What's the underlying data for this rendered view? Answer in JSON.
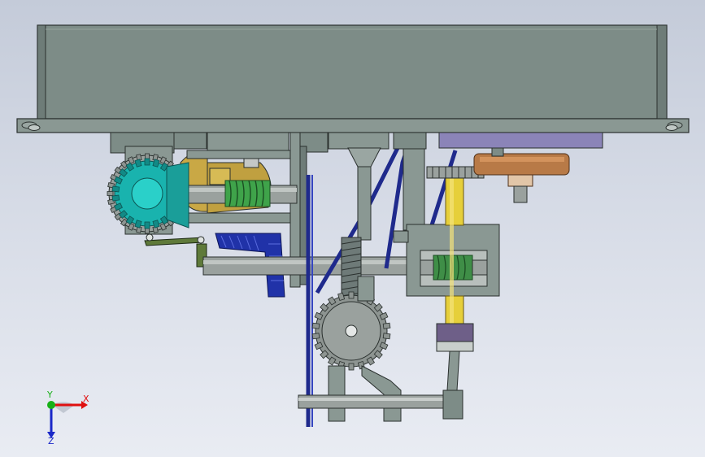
{
  "view": {
    "background_top": "#c4cbd9",
    "background_bottom": "#e9ecf3"
  },
  "triad": {
    "x_label": "X",
    "y_label": "Y",
    "z_label": "Z",
    "x_color": "#e01010",
    "y_color": "#18b018",
    "z_color": "#1a28c8"
  },
  "colors": {
    "housing": "#7d8c87",
    "frame_dark": "#5d6a66",
    "gear_teal": "#19b3ae",
    "gear_teal_dark": "#128a86",
    "gear_grey": "#9aa19e",
    "worm_green": "#3fa34a",
    "bevel_blue": "#2032a8",
    "belt_blue": "#1f2a8c",
    "shaft_yellow": "#e6cf3a",
    "cam_gold": "#c9a845",
    "bronze": "#b87a47",
    "plate_violet": "#8b84b8"
  },
  "parts": [
    "housing-top",
    "base-plate",
    "bevel-gear-left",
    "worm-gear-left",
    "bevel-gear-blue",
    "drive-belt",
    "spur-gear-center",
    "rack-vertical",
    "worm-box-right",
    "yellow-shaft",
    "bronze-pulley",
    "lower-shaft"
  ]
}
